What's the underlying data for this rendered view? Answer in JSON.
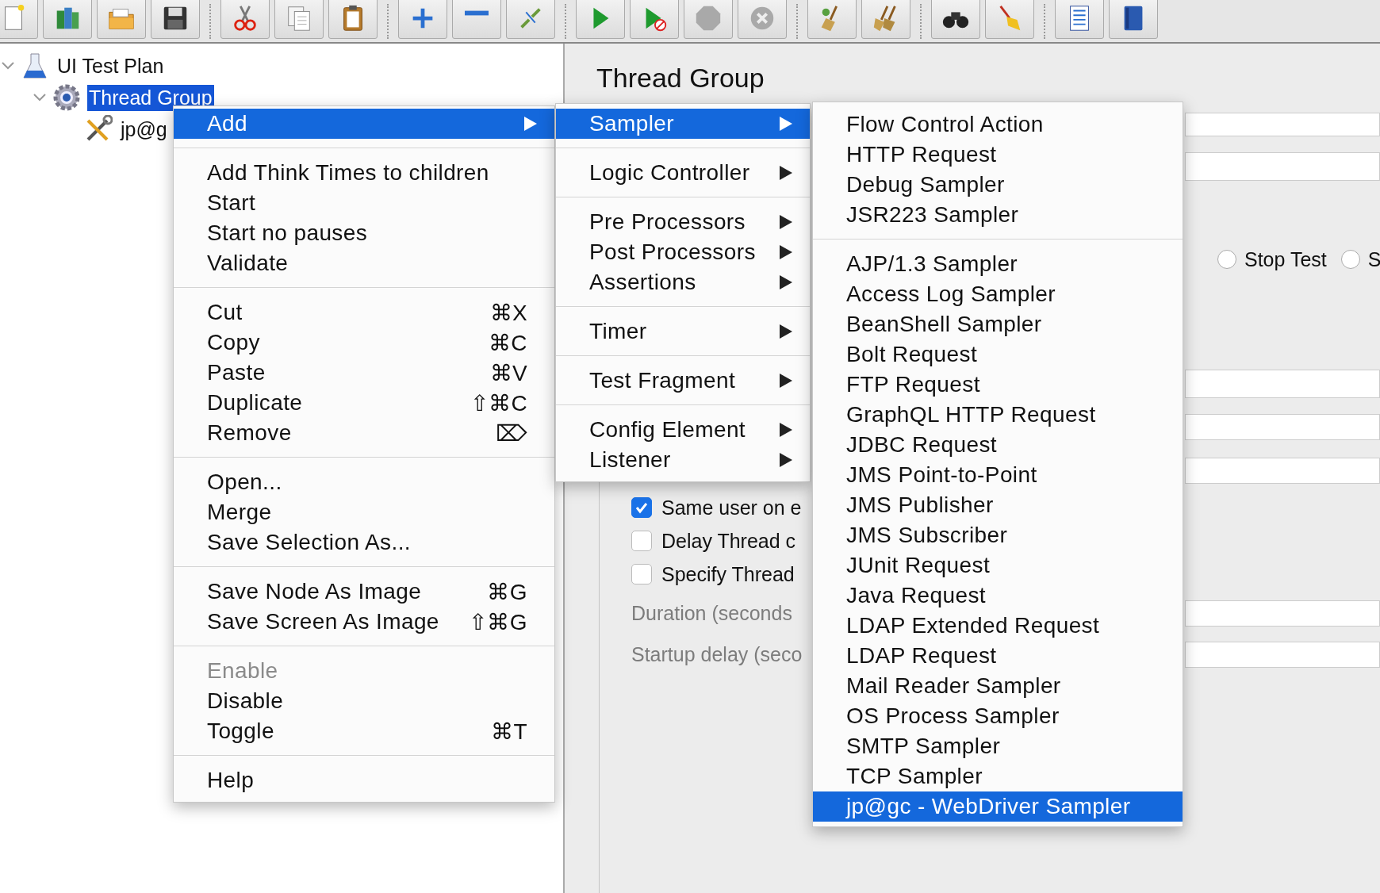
{
  "tree": {
    "items": [
      {
        "kind": "test-plan",
        "label": "UI Test Plan",
        "selected": false,
        "expanded": true,
        "children": [
          {
            "kind": "thread-group",
            "label": "Thread Group",
            "selected": true,
            "expanded": true,
            "children": [
              {
                "kind": "config",
                "label": "jp@g",
                "selected": false
              }
            ]
          }
        ]
      }
    ]
  },
  "panel": {
    "title": "Thread Group",
    "radios": [
      {
        "label": "Stop Test",
        "selected": false
      },
      {
        "label": "S",
        "selected": false
      }
    ],
    "checkboxes": [
      {
        "label": "Same user on e",
        "checked": true
      },
      {
        "label": "Delay Thread c",
        "checked": false
      },
      {
        "label": "Specify Thread",
        "checked": false
      }
    ],
    "disabled_labels": [
      "Duration (seconds",
      "Startup delay (seco"
    ]
  },
  "context_menu": {
    "sections": [
      [
        {
          "label": "Add",
          "submenu": true,
          "selected": true,
          "disabled": false
        }
      ],
      [
        {
          "label": "Add Think Times to children",
          "submenu": false,
          "selected": false,
          "disabled": false
        },
        {
          "label": "Start",
          "submenu": false,
          "selected": false,
          "disabled": false
        },
        {
          "label": "Start no pauses",
          "submenu": false,
          "selected": false,
          "disabled": false
        },
        {
          "label": "Validate",
          "submenu": false,
          "selected": false,
          "disabled": false
        }
      ],
      [
        {
          "label": "Cut",
          "shortcut": "⌘X",
          "submenu": false,
          "selected": false,
          "disabled": false
        },
        {
          "label": "Copy",
          "shortcut": "⌘C",
          "submenu": false,
          "selected": false,
          "disabled": false
        },
        {
          "label": "Paste",
          "shortcut": "⌘V",
          "submenu": false,
          "selected": false,
          "disabled": false
        },
        {
          "label": "Duplicate",
          "shortcut": "⇧⌘C",
          "submenu": false,
          "selected": false,
          "disabled": false
        },
        {
          "label": "Remove",
          "shortcut": "⌦",
          "submenu": false,
          "selected": false,
          "disabled": false
        }
      ],
      [
        {
          "label": "Open...",
          "submenu": false,
          "selected": false,
          "disabled": false
        },
        {
          "label": "Merge",
          "submenu": false,
          "selected": false,
          "disabled": false
        },
        {
          "label": "Save Selection As...",
          "submenu": false,
          "selected": false,
          "disabled": false
        }
      ],
      [
        {
          "label": "Save Node As Image",
          "shortcut": "⌘G",
          "submenu": false,
          "selected": false,
          "disabled": false
        },
        {
          "label": "Save Screen As Image",
          "shortcut": "⇧⌘G",
          "submenu": false,
          "selected": false,
          "disabled": false
        }
      ],
      [
        {
          "label": "Enable",
          "submenu": false,
          "selected": false,
          "disabled": true
        },
        {
          "label": "Disable",
          "submenu": false,
          "selected": false,
          "disabled": false
        },
        {
          "label": "Toggle",
          "shortcut": "⌘T",
          "submenu": false,
          "selected": false,
          "disabled": false
        }
      ],
      [
        {
          "label": "Help",
          "submenu": false,
          "selected": false,
          "disabled": false
        }
      ]
    ]
  },
  "add_menu": {
    "sections": [
      [
        {
          "label": "Sampler",
          "submenu": true,
          "selected": true
        }
      ],
      [
        {
          "label": "Logic Controller",
          "submenu": true,
          "selected": false
        }
      ],
      [
        {
          "label": "Pre Processors",
          "submenu": true,
          "selected": false
        },
        {
          "label": "Post Processors",
          "submenu": true,
          "selected": false
        },
        {
          "label": "Assertions",
          "submenu": true,
          "selected": false
        }
      ],
      [
        {
          "label": "Timer",
          "submenu": true,
          "selected": false
        }
      ],
      [
        {
          "label": "Test Fragment",
          "submenu": true,
          "selected": false
        }
      ],
      [
        {
          "label": "Config Element",
          "submenu": true,
          "selected": false
        },
        {
          "label": "Listener",
          "submenu": true,
          "selected": false
        }
      ]
    ]
  },
  "sampler_menu": {
    "sections": [
      [
        {
          "label": "Flow Control Action",
          "selected": false
        },
        {
          "label": "HTTP Request",
          "selected": false
        },
        {
          "label": "Debug Sampler",
          "selected": false
        },
        {
          "label": "JSR223 Sampler",
          "selected": false
        }
      ],
      [
        {
          "label": "AJP/1.3 Sampler",
          "selected": false
        },
        {
          "label": "Access Log Sampler",
          "selected": false
        },
        {
          "label": "BeanShell Sampler",
          "selected": false
        },
        {
          "label": "Bolt Request",
          "selected": false
        },
        {
          "label": "FTP Request",
          "selected": false
        },
        {
          "label": "GraphQL HTTP Request",
          "selected": false
        },
        {
          "label": "JDBC Request",
          "selected": false
        },
        {
          "label": "JMS Point-to-Point",
          "selected": false
        },
        {
          "label": "JMS Publisher",
          "selected": false
        },
        {
          "label": "JMS Subscriber",
          "selected": false
        },
        {
          "label": "JUnit Request",
          "selected": false
        },
        {
          "label": "Java Request",
          "selected": false
        },
        {
          "label": "LDAP Extended Request",
          "selected": false
        },
        {
          "label": "LDAP Request",
          "selected": false
        },
        {
          "label": "Mail Reader Sampler",
          "selected": false
        },
        {
          "label": "OS Process Sampler",
          "selected": false
        },
        {
          "label": "SMTP Sampler",
          "selected": false
        },
        {
          "label": "TCP Sampler",
          "selected": false
        },
        {
          "label": "jp@gc - WebDriver Sampler",
          "selected": true
        }
      ]
    ]
  }
}
